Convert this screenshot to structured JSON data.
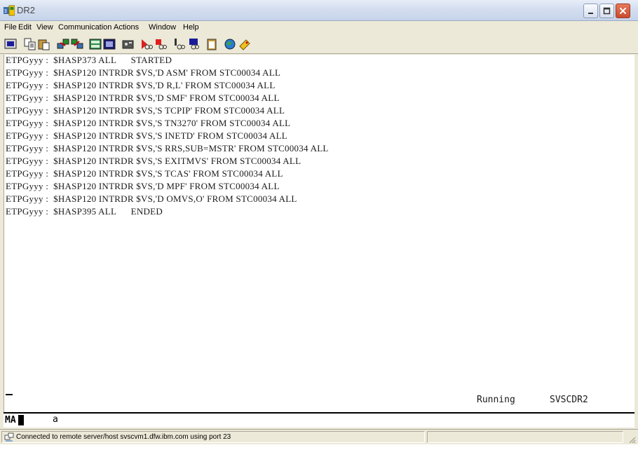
{
  "window": {
    "title": "DR2"
  },
  "menu": [
    "File",
    "Edit",
    "View",
    "Communication",
    "Actions",
    "Window",
    "Help"
  ],
  "toolbar_icons": [
    "print-screen-icon",
    "copy-icon",
    "paste-icon",
    "send-file-icon",
    "receive-file-icon",
    "keypad-icon",
    "display-icon",
    "record-macro-icon",
    "play-macro-icon",
    "stop-macro-icon",
    "macro-run-icon",
    "macro-edit-icon",
    "clipboard-icon",
    "globe-icon",
    "tag-icon"
  ],
  "terminal": {
    "lines": [
      "ETPGyyy :  $HASP373 ALL      STARTED",
      "ETPGyyy :  $HASP120 INTRDR $VS,'D ASM' FROM STC00034 ALL",
      "ETPGyyy :  $HASP120 INTRDR $VS,'D R,L' FROM STC00034 ALL",
      "ETPGyyy :  $HASP120 INTRDR $VS,'D SMF' FROM STC00034 ALL",
      "ETPGyyy :  $HASP120 INTRDR $VS,'S TCPIP' FROM STC00034 ALL",
      "ETPGyyy :  $HASP120 INTRDR $VS,'S TN3270' FROM STC00034 ALL",
      "ETPGyyy :  $HASP120 INTRDR $VS,'S INETD' FROM STC00034 ALL",
      "ETPGyyy :  $HASP120 INTRDR $VS,'S RRS,SUB=MSTR' FROM STC00034 ALL",
      "ETPGyyy :  $HASP120 INTRDR $VS,'S EXITMVS' FROM STC00034 ALL",
      "ETPGyyy :  $HASP120 INTRDR $VS,'S TCAS' FROM STC00034 ALL",
      "ETPGyyy :  $HASP120 INTRDR $VS,'D MPF' FROM STC00034 ALL",
      "ETPGyyy :  $HASP120 INTRDR $VS,'D OMVS,O' FROM STC00034 ALL",
      "ETPGyyy :  $HASP395 ALL      ENDED"
    ],
    "status": "Running",
    "system": "SVSCDR2"
  },
  "oia": {
    "indicator": "MA",
    "input": "a"
  },
  "statusbar": {
    "message": "Connected to remote server/host svscvm1.dfw.ibm.com using port 23"
  }
}
